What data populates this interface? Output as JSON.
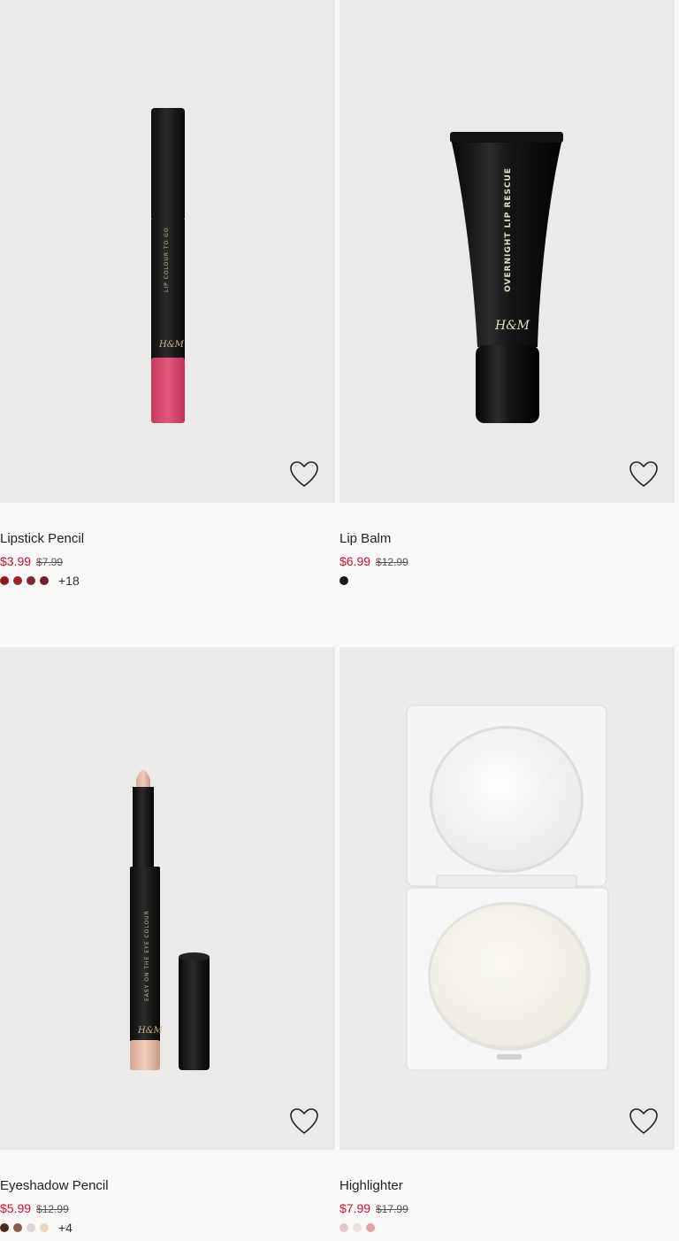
{
  "products": [
    {
      "name": "Lipstick Pencil",
      "sale_price": "$3.99",
      "original_price": "$7.99",
      "swatches": [
        "#8b1a1f",
        "#a0212a",
        "#7a2c2a",
        "#6e2228"
      ],
      "more_colors": "+18",
      "product_text": "LIP COLOUR TO GO"
    },
    {
      "name": "Lip Balm",
      "sale_price": "$6.99",
      "original_price": "$12.99",
      "swatches": [
        "#1a1a1a"
      ],
      "more_colors": "",
      "product_text": "OVERNIGHT LIP RESCUE"
    },
    {
      "name": "Eyeshadow Pencil",
      "sale_price": "$5.99",
      "original_price": "$12.99",
      "swatches": [
        "#4a2a22",
        "#8a5e4e",
        "#d9d6d6",
        "#ead7c2"
      ],
      "more_colors": "+4",
      "product_text": "EASY ON THE EYE COLOUR"
    },
    {
      "name": "Highlighter",
      "sale_price": "$7.99",
      "original_price": "$17.99",
      "swatches": [
        "#e8c7c7",
        "#e9e0df",
        "#e2a3a7"
      ],
      "more_colors": ""
    }
  ],
  "brand_mark": "H&M"
}
